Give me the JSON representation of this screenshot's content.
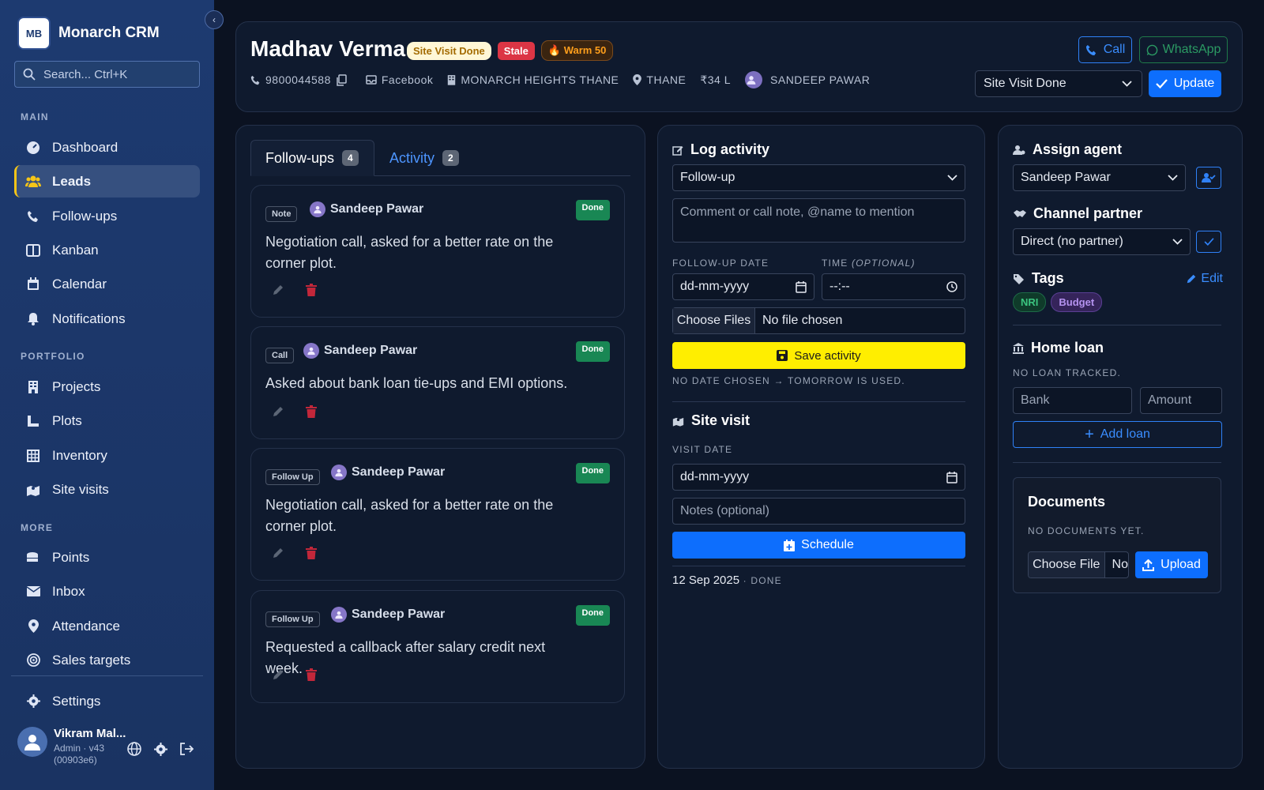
{
  "app": {
    "name": "Monarch CRM",
    "logo_text": "MB"
  },
  "search": {
    "placeholder": "Search...  Ctrl+K"
  },
  "nav": {
    "sections": {
      "main": "MAIN",
      "portfolio": "PORTFOLIO",
      "more": "MORE"
    },
    "items": {
      "dashboard": "Dashboard",
      "leads": "Leads",
      "followups": "Follow-ups",
      "kanban": "Kanban",
      "calendar": "Calendar",
      "notifications": "Notifications",
      "projects": "Projects",
      "plots": "Plots",
      "inventory": "Inventory",
      "site_visits": "Site visits",
      "points": "Points",
      "inbox": "Inbox",
      "attendance": "Attendance",
      "sales_targets": "Sales targets",
      "settings": "Settings"
    },
    "active": "Leads"
  },
  "user": {
    "name": "Vikram Mal...",
    "role": "Admin · v43",
    "build": "(00903e6)"
  },
  "lead": {
    "name": "Madhav Verma",
    "badges": {
      "status": "Site Visit Done",
      "stale": "Stale",
      "warm": "Warm 50"
    },
    "phone": "9800044588",
    "source": "Facebook",
    "project": "MONARCH HEIGHTS THANE",
    "location": "THANE",
    "budget": "₹34 L",
    "agent": "SANDEEP PAWAR"
  },
  "header_actions": {
    "call": "Call",
    "whatsapp": "WhatsApp",
    "status_value": "Site Visit Done",
    "update": "Update"
  },
  "tabs": {
    "followups": "Follow-ups",
    "followups_count": "4",
    "activity": "Activity",
    "activity_count": "2"
  },
  "followups": [
    {
      "type": "Note",
      "author": "Sandeep Pawar",
      "status": "Done",
      "text": "Negotiation call, asked for a better rate on the corner plot."
    },
    {
      "type": "Call",
      "author": "Sandeep Pawar",
      "status": "Done",
      "text": "Asked about bank loan tie-ups and EMI options."
    },
    {
      "type": "Follow Up",
      "author": "Sandeep Pawar",
      "status": "Done",
      "text": "Negotiation call, asked for a better rate on the corner plot."
    },
    {
      "type": "Follow Up",
      "author": "Sandeep Pawar",
      "status": "Done",
      "text": "Requested a callback after salary credit next week."
    }
  ],
  "log_activity": {
    "title": "Log activity",
    "type_value": "Follow-up",
    "comment_placeholder": "Comment or call note, @name to mention",
    "date_label": "FOLLOW-UP DATE",
    "time_label": "TIME",
    "time_optional": "(OPTIONAL)",
    "date_placeholder": "dd-mm-yyyy",
    "time_placeholder": "--:--",
    "choose_files": "Choose Files",
    "no_file": "No file chosen",
    "save": "Save activity",
    "hint": "NO DATE CHOSEN → TOMORROW IS USED."
  },
  "site_visit": {
    "title": "Site visit",
    "date_label": "VISIT DATE",
    "date_placeholder": "dd-mm-yyyy",
    "notes_placeholder": "Notes (optional)",
    "schedule": "Schedule",
    "history_date": "12 Sep 2025",
    "history_status": " · DONE"
  },
  "assign_agent": {
    "title": "Assign agent",
    "value": "Sandeep Pawar"
  },
  "channel_partner": {
    "title": "Channel partner",
    "value": "Direct (no partner)"
  },
  "tags": {
    "title": "Tags",
    "edit": "Edit",
    "items": [
      "NRI",
      "Budget"
    ]
  },
  "home_loan": {
    "title": "Home loan",
    "empty": "NO LOAN TRACKED.",
    "bank_placeholder": "Bank",
    "amount_placeholder": "Amount",
    "add": "Add loan"
  },
  "documents": {
    "title": "Documents",
    "empty": "NO DOCUMENTS YET.",
    "choose_file": "Choose File",
    "no_file_short": "No",
    "upload": "Upload"
  },
  "colors": {
    "accent": "#0d6efd",
    "done": "#198754",
    "stale": "#dc3545",
    "save": "#ffee00",
    "sidebar": "#1d3a70"
  }
}
